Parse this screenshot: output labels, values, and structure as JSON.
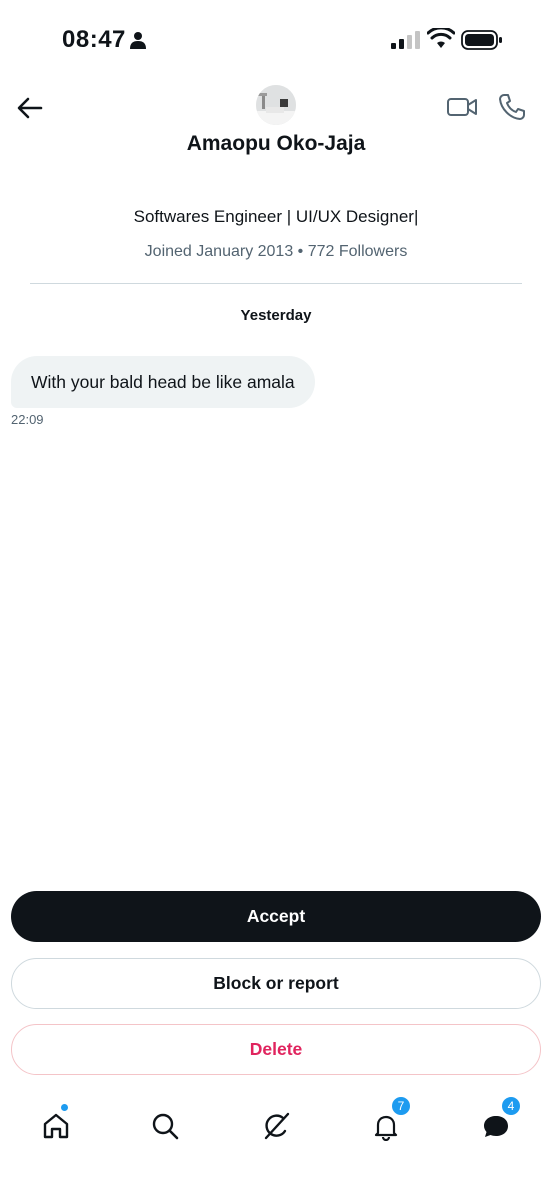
{
  "status_bar": {
    "time": "08:47",
    "icons": [
      "person-icon",
      "signal-icon",
      "wifi-icon",
      "battery-icon"
    ]
  },
  "header": {
    "back_icon": "arrow-left-icon",
    "video_icon": "video-call-icon",
    "call_icon": "phone-icon",
    "contact_name": "Amaopu Oko-Jaja"
  },
  "profile": {
    "bio": "Softwares Engineer | UI/UX Designer|",
    "meta": "Joined January 2013 • 772 Followers"
  },
  "conversation": {
    "day_label": "Yesterday",
    "messages": [
      {
        "text": "With your bald head be like amala",
        "time": "22:09"
      }
    ]
  },
  "actions": {
    "accept": "Accept",
    "block_or_report": "Block or report",
    "delete": "Delete"
  },
  "bottom_nav": {
    "items": [
      {
        "name": "home",
        "icon": "home-icon",
        "has_dot": true
      },
      {
        "name": "search",
        "icon": "search-icon"
      },
      {
        "name": "grok",
        "icon": "grok-icon"
      },
      {
        "name": "notifications",
        "icon": "bell-icon",
        "badge": "7"
      },
      {
        "name": "messages",
        "icon": "messages-icon",
        "badge": "4"
      }
    ]
  },
  "colors": {
    "text": "#0f1419",
    "secondary_text": "#536471",
    "bubble": "#eff3f4",
    "accent": "#1d9bf0",
    "danger": "#e0245e",
    "accept_bg": "#0f1419"
  }
}
